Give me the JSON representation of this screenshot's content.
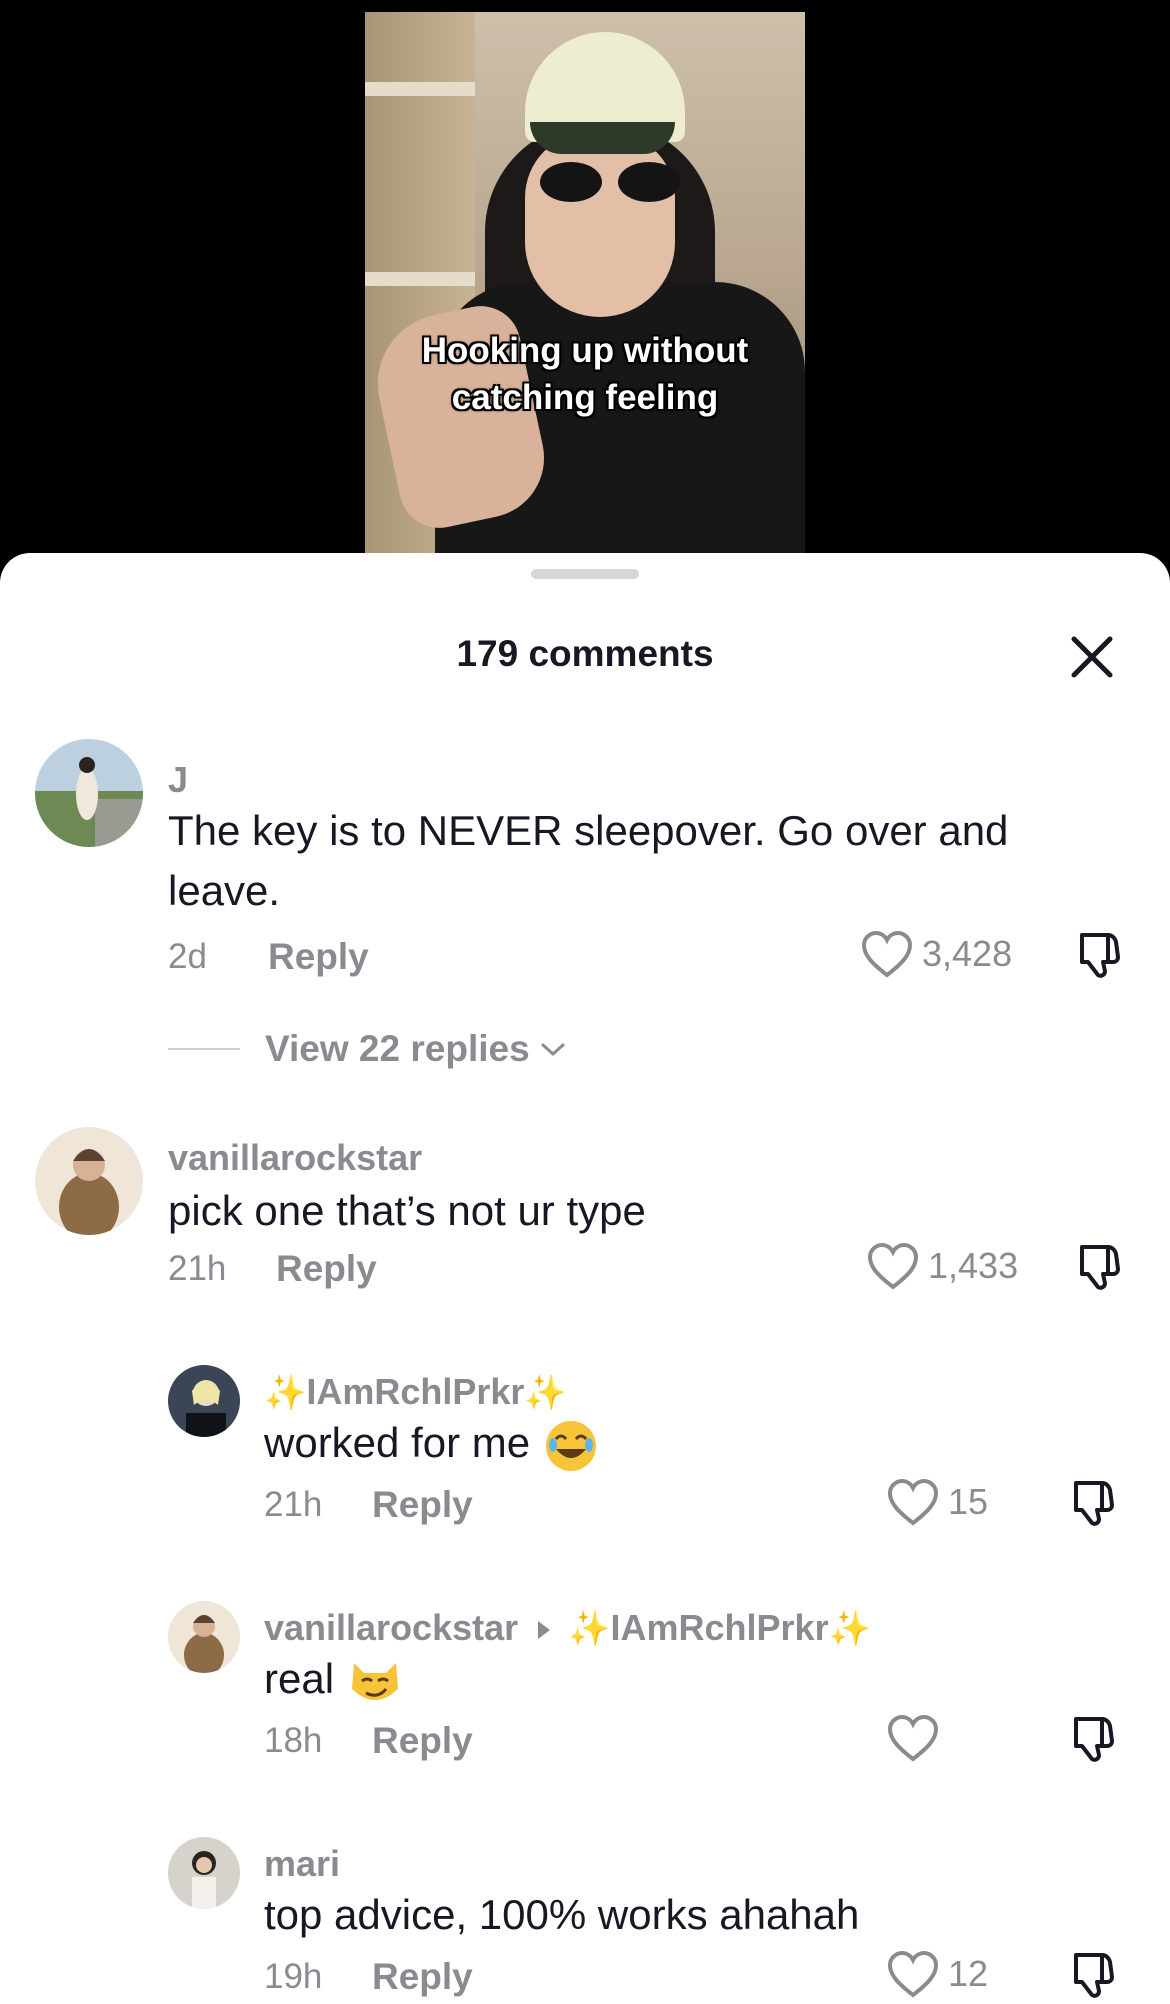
{
  "video": {
    "caption_line1": "Hooking up without",
    "caption_line2": "catching feeling"
  },
  "sheet": {
    "title": "179 comments"
  },
  "comments": [
    {
      "username": "J",
      "text_line1": "The key is to NEVER sleepover. Go over and",
      "text_line2": "leave.",
      "time": "2d",
      "reply_label": "Reply",
      "likes": "3,428",
      "view_replies": "View 22 replies"
    },
    {
      "username": "vanillarockstar",
      "text": "pick one that’s not ur type",
      "time": "21h",
      "reply_label": "Reply",
      "likes": "1,433"
    }
  ],
  "replies": [
    {
      "username": "IAmRchlPrkr",
      "sparkle": "✨",
      "text": "worked for me",
      "emoji": "joy-face",
      "time": "21h",
      "reply_label": "Reply",
      "likes": "15"
    },
    {
      "username": "vanillarockstar",
      "reply_to": "IAmRchlPrkr",
      "sparkle": "✨",
      "text": "real",
      "emoji": "smirk-cat-face",
      "time": "18h",
      "reply_label": "Reply",
      "likes": ""
    },
    {
      "username": "mari",
      "text": "top advice, 100% works ahahah",
      "time": "19h",
      "reply_label": "Reply",
      "likes": "12"
    }
  ],
  "colors": {
    "text_primary": "#161823",
    "text_secondary": "#8a8b91",
    "sparkle": "#f4c431",
    "sheet_bg": "#ffffff",
    "video_bg": "#000000"
  }
}
